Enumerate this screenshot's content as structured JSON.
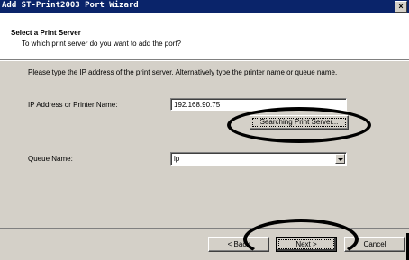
{
  "window": {
    "title": "Add ST-Print2003 Port Wizard",
    "close_label": "×"
  },
  "header": {
    "title": "Select a Print Server",
    "subtitle": "To which print server do you want to add the port?"
  },
  "body": {
    "instruction": "Please type the IP address of the print server. Alternatively type the printer name or queue name.",
    "ip_label": "IP Address or Printer Name:",
    "ip_value": "192.168.90.75",
    "search_button": "Searching Print Server...",
    "queue_label": "Queue Name:",
    "queue_value": "lp"
  },
  "footer": {
    "back_label": "< Back",
    "next_label": "Next >",
    "cancel_label": "Cancel"
  }
}
